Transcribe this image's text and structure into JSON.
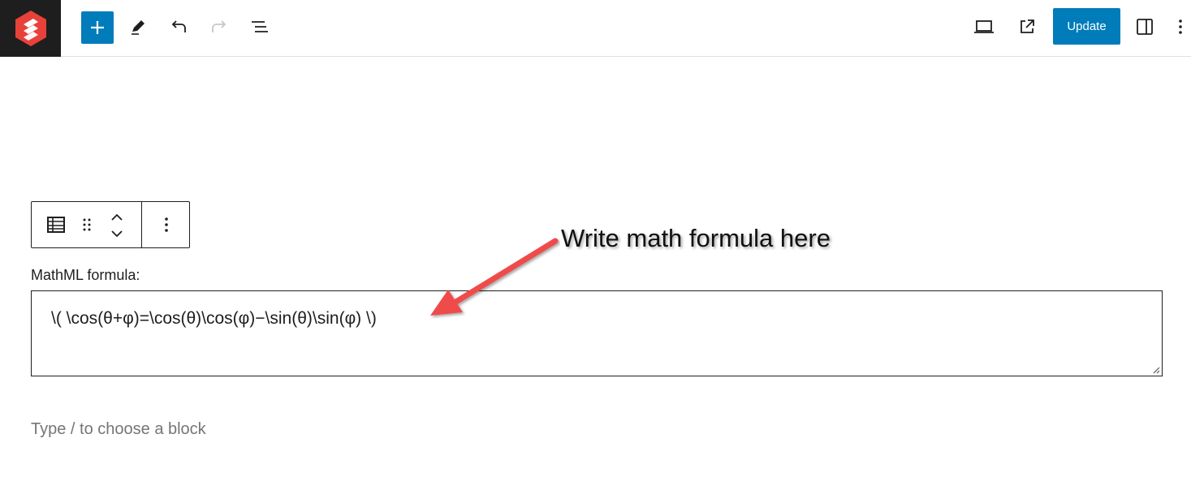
{
  "toolbar": {
    "add_icon": "plus-icon",
    "tools_icon": "pencil-icon",
    "undo_icon": "undo-icon",
    "redo_icon": "redo-icon",
    "list_view_icon": "list-view-icon",
    "preview_icon": "laptop-icon",
    "view_post_icon": "external-link-icon",
    "update_label": "Update",
    "settings_icon": "sidebar-toggle-icon",
    "options_icon": "vertical-ellipsis-icon",
    "accent_color": "#007cba",
    "logo_color": "#e8413a"
  },
  "block_toolbar": {
    "block_type_icon": "table-block-icon",
    "drag_icon": "drag-handle-icon",
    "move_up_icon": "chevron-up-icon",
    "move_down_icon": "chevron-down-icon",
    "options_icon": "vertical-ellipsis-icon"
  },
  "formula_block": {
    "label": "MathML formula:",
    "value": "\\( \\cos(θ+φ)=\\cos(θ)\\cos(φ)−\\sin(θ)\\sin(φ) \\)"
  },
  "editor": {
    "placeholder": "Type / to choose a block"
  },
  "annotation": {
    "text": "Write math formula here",
    "arrow_color": "#ef4b4b"
  }
}
